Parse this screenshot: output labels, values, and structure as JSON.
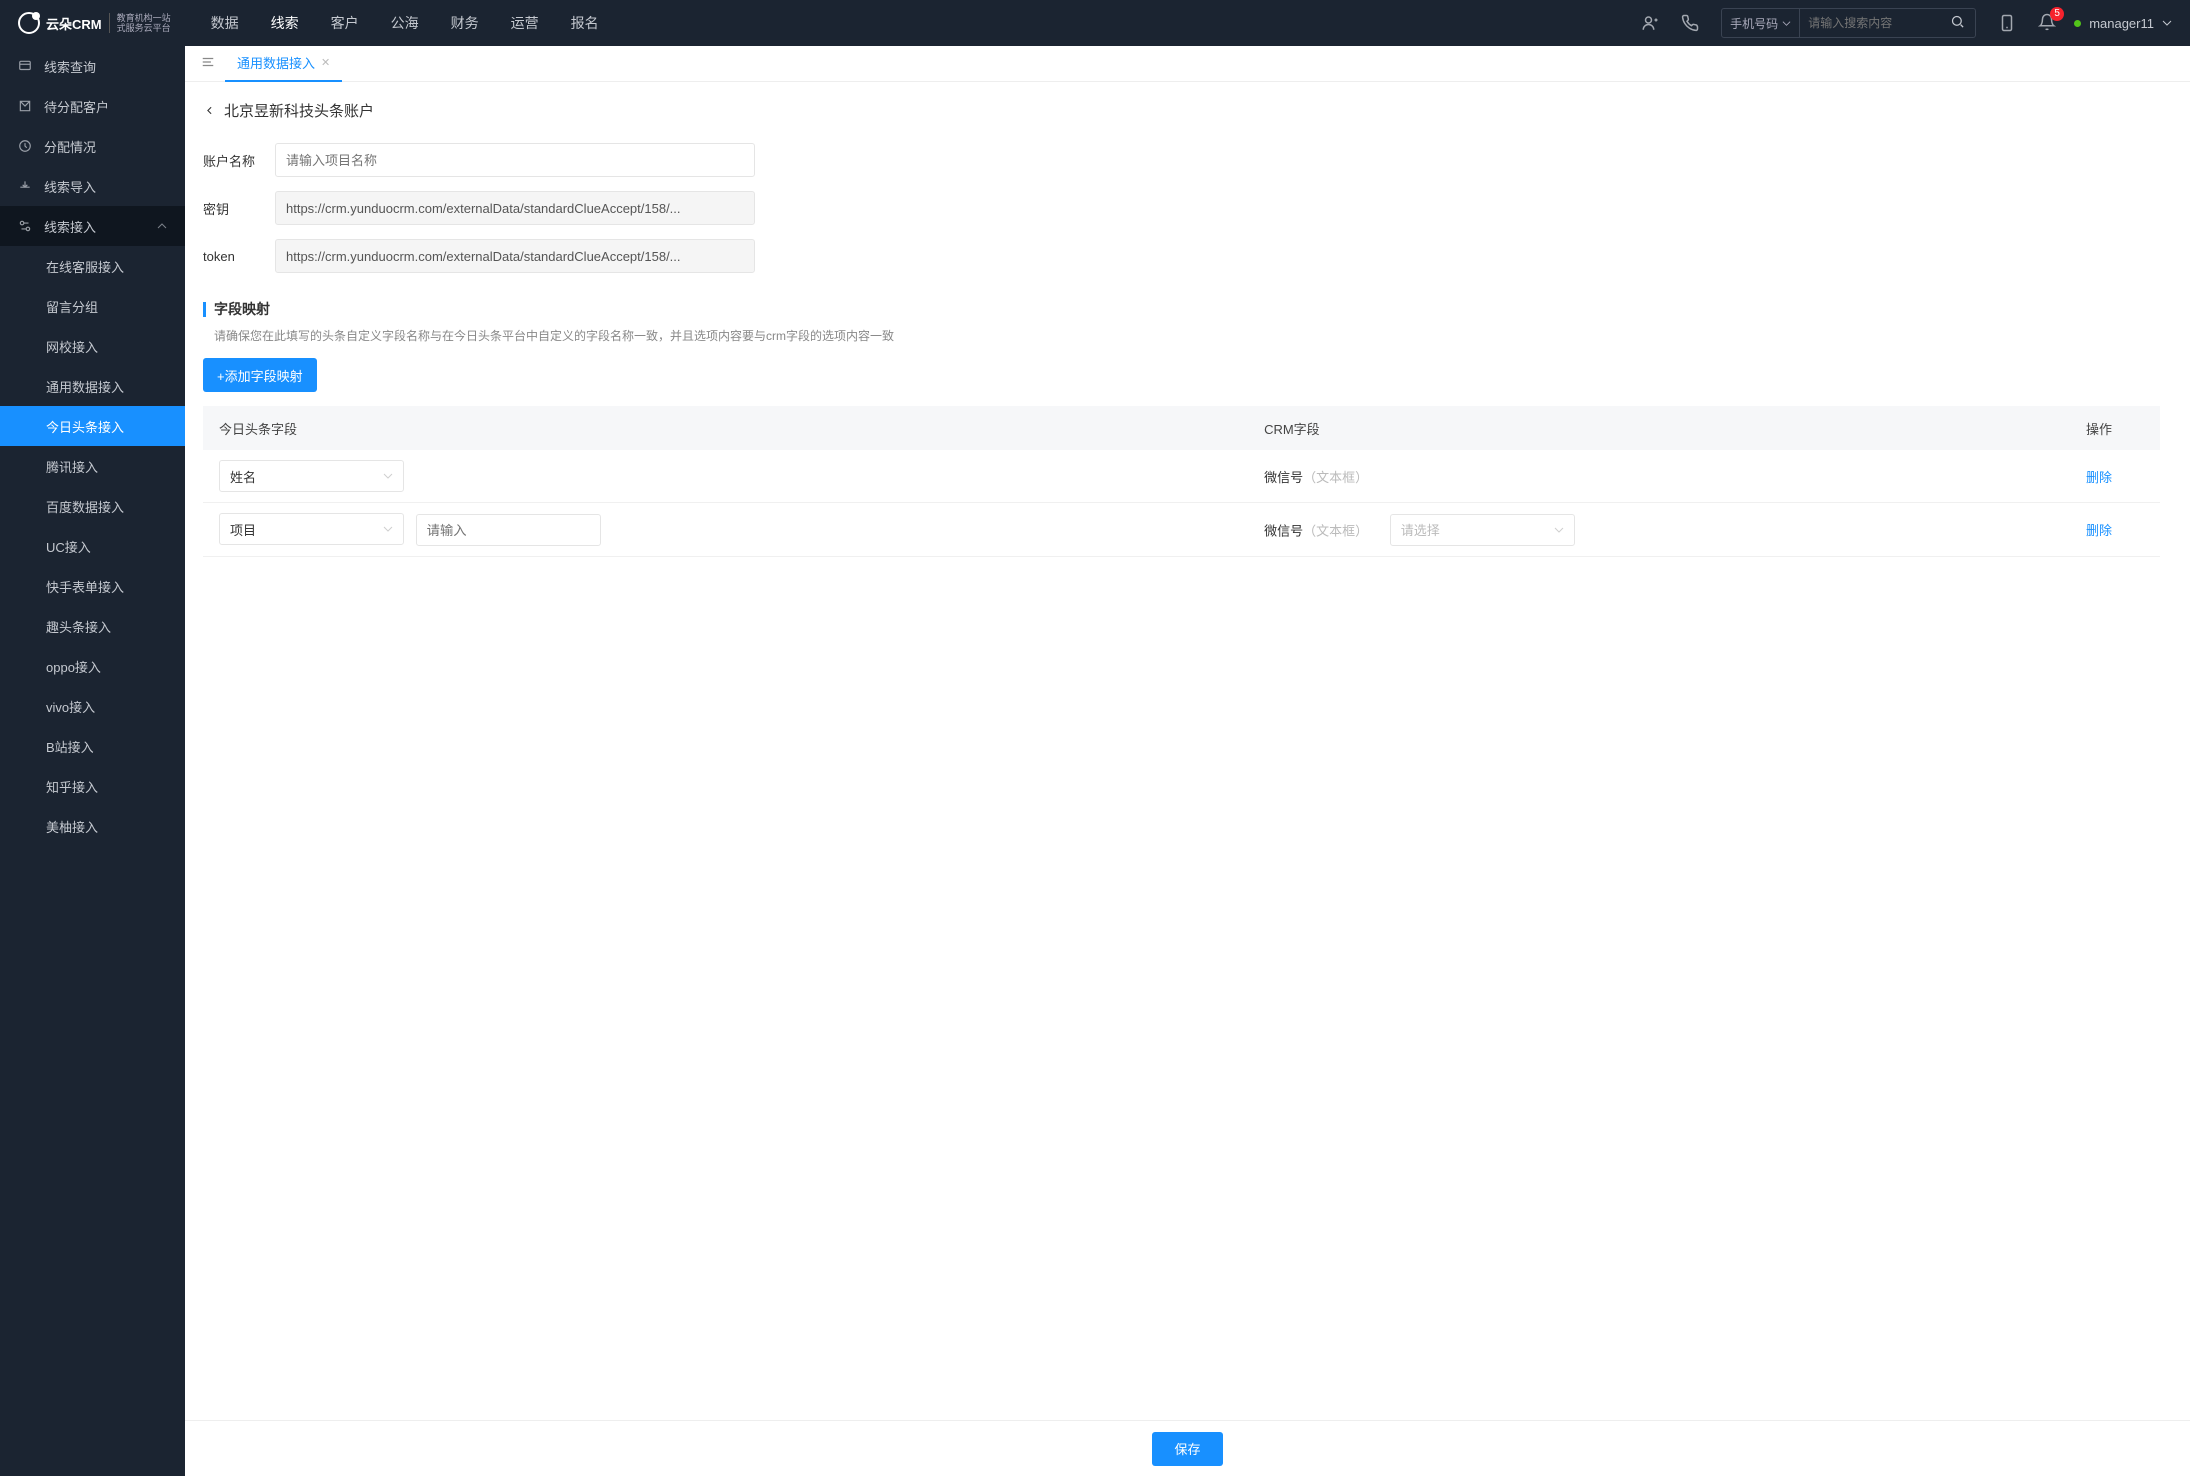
{
  "logo": {
    "name": "云朵CRM",
    "sub1": "教育机构一站",
    "sub2": "式服务云平台"
  },
  "topnav": [
    "数据",
    "线索",
    "客户",
    "公海",
    "财务",
    "运营",
    "报名"
  ],
  "topnav_active": 1,
  "search": {
    "type": "手机号码",
    "placeholder": "请输入搜索内容"
  },
  "notif_count": "5",
  "user": "manager11",
  "sidebar": {
    "items": [
      {
        "label": "线索查询"
      },
      {
        "label": "待分配客户"
      },
      {
        "label": "分配情况"
      },
      {
        "label": "线索导入"
      },
      {
        "label": "线索接入",
        "open": true,
        "children": [
          "在线客服接入",
          "留言分组",
          "网校接入",
          "通用数据接入",
          "今日头条接入",
          "腾讯接入",
          "百度数据接入",
          "UC接入",
          "快手表单接入",
          "趣头条接入",
          "oppo接入",
          "vivo接入",
          "B站接入",
          "知乎接入",
          "美柚接入"
        ],
        "active_child": 4
      }
    ]
  },
  "tab": {
    "label": "通用数据接入"
  },
  "page": {
    "title": "北京昱新科技头条账户",
    "fields": {
      "name_label": "账户名称",
      "name_placeholder": "请输入项目名称",
      "secret_label": "密钥",
      "secret_value": "https://crm.yunduocrm.com/externalData/standardClueAccept/158/...",
      "token_label": "token",
      "token_value": "https://crm.yunduocrm.com/externalData/standardClueAccept/158/..."
    },
    "section": {
      "title": "字段映射",
      "hint": "请确保您在此填写的头条自定义字段名称与在今日头条平台中自定义的字段名称一致，并且选项内容要与crm字段的选项内容一致"
    },
    "add_btn": "+添加字段映射",
    "table": {
      "headers": [
        "今日头条字段",
        "CRM字段",
        "操作"
      ],
      "rows": [
        {
          "tt_sel": "姓名",
          "tt_input": null,
          "crm_label": "微信号",
          "crm_hint": "（文本框）",
          "crm_sel": null,
          "del": "删除"
        },
        {
          "tt_sel": "项目",
          "tt_input_placeholder": "请输入",
          "crm_label": "微信号",
          "crm_hint": "（文本框）",
          "crm_sel_placeholder": "请选择",
          "del": "删除"
        }
      ]
    },
    "save": "保存"
  }
}
